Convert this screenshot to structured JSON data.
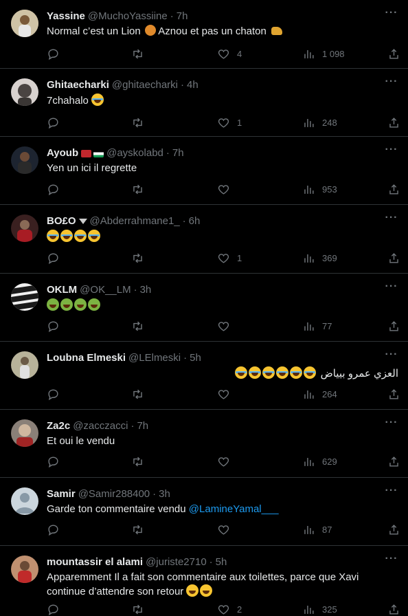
{
  "tweets": [
    {
      "name": "Yassine",
      "handle": "@MuchoYassiine",
      "time": "7h",
      "text": "Normal c’est un Lion",
      "text2": "Aznou et pas un chaton",
      "reply": "",
      "retweet": "",
      "likes": "4",
      "views": "1 098",
      "avatar_color": "#c9b89a"
    },
    {
      "name": "Ghitaecharki",
      "handle": "@ghitaecharki",
      "time": "4h",
      "text": "7chahalo",
      "reply": "",
      "retweet": "",
      "likes": "1",
      "views": "248",
      "avatar_color": "#6f6a68"
    },
    {
      "name": "Ayoub",
      "handle": "@ayskolabd",
      "time": "7h",
      "text": "Yen un ici il regrette",
      "reply": "",
      "retweet": "",
      "likes": "",
      "views": "953",
      "avatar_color": "#2d3440"
    },
    {
      "name": "BO£O",
      "handle": "@Abderrahmane1_",
      "time": "6h",
      "text": "",
      "reply": "",
      "retweet": "",
      "likes": "1",
      "views": "369",
      "avatar_color": "#4a2a28"
    },
    {
      "name": "OKLM",
      "handle": "@OK__LM",
      "time": "3h",
      "text": "",
      "reply": "",
      "retweet": "",
      "likes": "",
      "views": "77",
      "avatar_color": "#e6e6e6"
    },
    {
      "name": "Loubna Elmeski",
      "handle": "@LElmeski",
      "time": "5h",
      "text": "العزي عمرو بيياض",
      "reply": "",
      "retweet": "",
      "likes": "",
      "views": "264",
      "avatar_color": "#a8a58c"
    },
    {
      "name": "Za2c",
      "handle": "@zacczacci",
      "time": "7h",
      "text": "Et oui le vendu",
      "reply": "",
      "retweet": "",
      "likes": "",
      "views": "629",
      "avatar_color": "#7a6c62"
    },
    {
      "name": "Samir",
      "handle": "@Samir288400",
      "time": "3h",
      "text": "Garde ton commentaire vendu",
      "mention": "@LamineYamal___",
      "reply": "",
      "retweet": "",
      "likes": "",
      "views": "87",
      "avatar_color": "#aab8c2"
    },
    {
      "name": "mountassir el alami",
      "handle": "@juriste2710",
      "time": "5h",
      "text": "Apparemment Il a fait son commentaire aux toilettes, parce que Xavi",
      "text2": "continue d’attendre son retour",
      "reply": "",
      "retweet": "",
      "likes": "2",
      "views": "325",
      "avatar_color": "#b07a5a"
    }
  ],
  "more_label": "···",
  "separator": "·",
  "colors": {
    "background": "#000000",
    "text": "#e7e9ea",
    "muted": "#71767b",
    "link": "#1d9bf0",
    "border": "#2f3336"
  },
  "icons": [
    "reply-icon",
    "retweet-icon",
    "like-icon",
    "views-icon",
    "share-icon",
    "more-icon"
  ]
}
